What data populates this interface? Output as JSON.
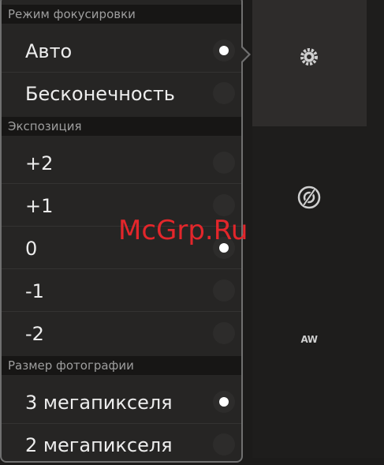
{
  "focus_section": {
    "title": "Режим фокусировки",
    "options": [
      {
        "label": "Авто",
        "selected": true
      },
      {
        "label": "Бесконечность",
        "selected": false
      }
    ]
  },
  "exposure_section": {
    "title": "Экспозиция",
    "options": [
      {
        "label": "+2",
        "selected": false
      },
      {
        "label": "+1",
        "selected": false
      },
      {
        "label": "0",
        "selected": true
      },
      {
        "label": "-1",
        "selected": false
      },
      {
        "label": "-2",
        "selected": false
      }
    ]
  },
  "size_section": {
    "title": "Размер фотографии",
    "options": [
      {
        "label": "3 мегапикселя",
        "selected": true
      },
      {
        "label": "2 мегапикселя",
        "selected": false
      }
    ]
  },
  "side_controls": {
    "wb_label": "AW",
    "icons": [
      "settings-icon",
      "flash-auto-icon",
      "white-balance-icon"
    ]
  },
  "watermark": "McGrp.Ru",
  "colors": {
    "selected_dot": "#ffffff",
    "watermark": "#e3262b"
  }
}
